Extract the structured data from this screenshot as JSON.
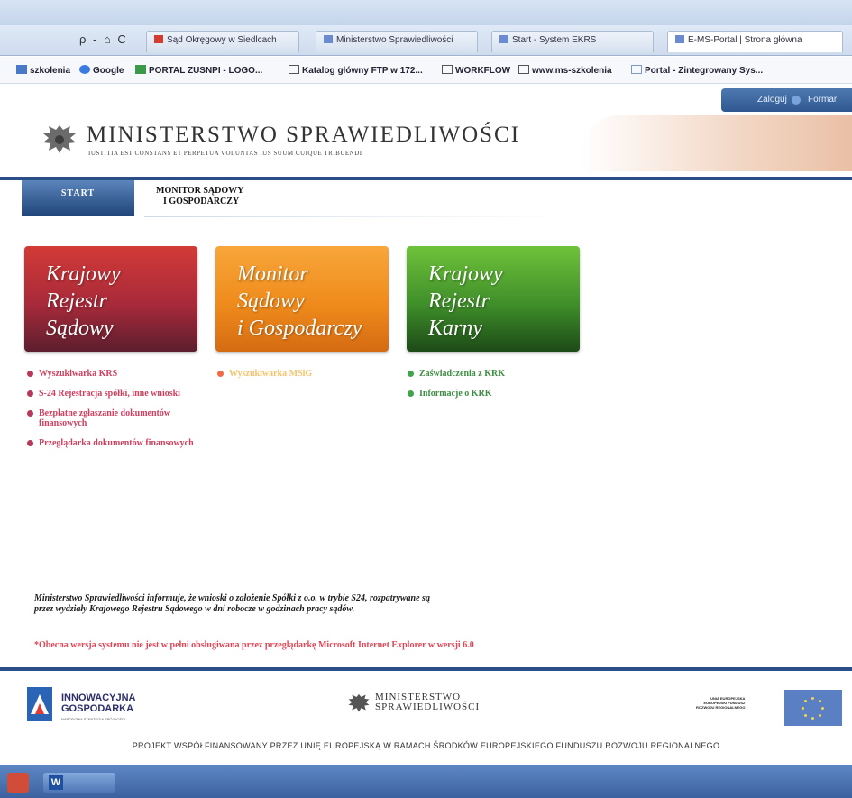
{
  "browser": {
    "tools": "ρ - ⌂ C",
    "tabs": [
      {
        "label": "Sąd Okręgowy w Siedlcach",
        "color": "#d63b2f"
      },
      {
        "label": "Ministerstwo Sprawiedliwości",
        "color": "#6b8ad0"
      },
      {
        "label": "Start - System EKRS",
        "color": "#6b8ad0"
      },
      {
        "label": "E-MS-Portal | Strona główna",
        "color": "#6b8ad0"
      }
    ],
    "favorites": [
      {
        "label": "szkolenia",
        "icon": "link-icon"
      },
      {
        "label": "Google",
        "icon": "google-icon"
      },
      {
        "label": "PORTAL ZUSNPI - LOGO...",
        "icon": "portal-icon"
      },
      {
        "label": "Katalog główny FTP w 172...",
        "icon": "page-icon"
      },
      {
        "label": "WORKFLOW",
        "icon": "page-icon"
      },
      {
        "label": "www.ms-szkolenia",
        "icon": "page-icon"
      },
      {
        "label": "Portal - Zintegrowany Sys...",
        "icon": "page-icon"
      }
    ]
  },
  "header": {
    "login": "Zaloguj",
    "contact": "Formar",
    "title": "MINISTERSTWO SPRAWIEDLIWOŚCI",
    "motto": "IUSTITIA EST CONSTANS ET PERPETUA VOLUNTAS IUS SUUM CUIQUE TRIBUENDI",
    "nav_start": "START",
    "nav_monitor_line1": "MONITOR SĄDOWY",
    "nav_monitor_line2": "I GOSPODARCZY"
  },
  "tiles": {
    "krs": [
      "Krajowy",
      "Rejestr",
      "Sądowy"
    ],
    "msig": [
      "Monitor",
      "Sądowy",
      "i Gospodarczy"
    ],
    "krk": [
      "Krajowy",
      "Rejestr",
      "Karny"
    ]
  },
  "links": {
    "krs": [
      "Wyszukiwarka KRS",
      "S-24 Rejestracja spółki, inne wnioski",
      "Bezpłatne zgłaszanie dokumentów finansowych",
      "Przeglądarka dokumentów finansowych"
    ],
    "msig": [
      "Wyszukiwarka MSiG"
    ],
    "krk": [
      "Zaświadczenia z KRK",
      "Informacje o KRK"
    ]
  },
  "notices": {
    "info": "Ministerstwo Sprawiedliwości informuje, że wnioski o założenie Spółki z o.o. w trybie S24, rozpatrywane są przez wydziały Krajowego Rejestru Sądowego w dni robocze w godzinach pracy sądów.",
    "warning": "*Obecna wersja systemu nie jest w pełni obsługiwana przez przeglądarkę Microsoft Internet Explorer w wersji 6.0"
  },
  "footer": {
    "ig_line1": "INNOWACYJNA",
    "ig_line2": "GOSPODARKA",
    "ig_sub": "NARODOWA STRATEGIA SPÓJNOŚCI",
    "ms_line1": "MINISTERSTWO",
    "ms_line2": "SPRAWIEDLIWOŚCI",
    "ue_line1": "UNIA EUROPEJSKA",
    "ue_line2": "EUROPEJSKI FUNDUSZ",
    "ue_line3": "ROZWOJU REGIONALNEGO",
    "project": "PROJEKT WSPÓŁFINANSOWANY PRZEZ UNIĘ EUROPEJSKĄ W RAMACH ŚRODKÓW EUROPEJSKIEGO FUNDUSZU ROZWOJU REGIONALNEGO"
  },
  "taskbar": {
    "word_glyph": "W"
  }
}
